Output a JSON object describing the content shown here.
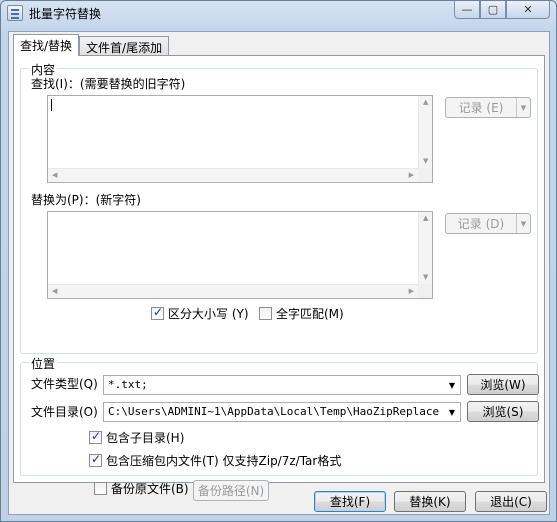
{
  "window": {
    "title": "批量字符替换",
    "min_glyph": "—",
    "max_glyph": "▢",
    "close_glyph": "✕"
  },
  "tabs": [
    {
      "label": "查找/替换",
      "active": true
    },
    {
      "label": "文件首/尾添加",
      "active": false
    }
  ],
  "content": {
    "legend": "内容",
    "find_label": "查找(I)：(需要替换的旧字符)",
    "replace_label": "替换为(P)：(新字符)",
    "find_history_button": "记录 (E)",
    "replace_history_button": "记录 (D)",
    "case_sensitive_label": "区分大小写 (Y)",
    "case_sensitive_checked": true,
    "whole_match_label": "全字匹配(M)",
    "whole_match_checked": false
  },
  "location": {
    "legend": "位置",
    "file_type_label": "文件类型(Q)",
    "file_type_value": "*.txt;",
    "file_dir_label": "文件目录(O)",
    "file_dir_value": "C:\\Users\\ADMINI~1\\AppData\\Local\\Temp\\HaoZipReplace",
    "browse_type_button": "浏览(W)",
    "browse_dir_button": "浏览(S)",
    "include_subdirs_label": "包含子目录(H)",
    "include_subdirs_checked": true,
    "include_archives_label": "包含压缩包内文件(T) 仅支持Zip/7z/Tar格式",
    "include_archives_checked": true,
    "backup_label": "备份原文件(B)",
    "backup_checked": false,
    "backup_path_button": "备份路径(N)"
  },
  "footer": {
    "find_button": "查找(F)",
    "replace_button": "替换(K)",
    "exit_button": "退出(C)"
  },
  "icons": {
    "dropdown": "▼",
    "up": "▲",
    "down": "▼",
    "left": "◀",
    "right": "▶"
  }
}
